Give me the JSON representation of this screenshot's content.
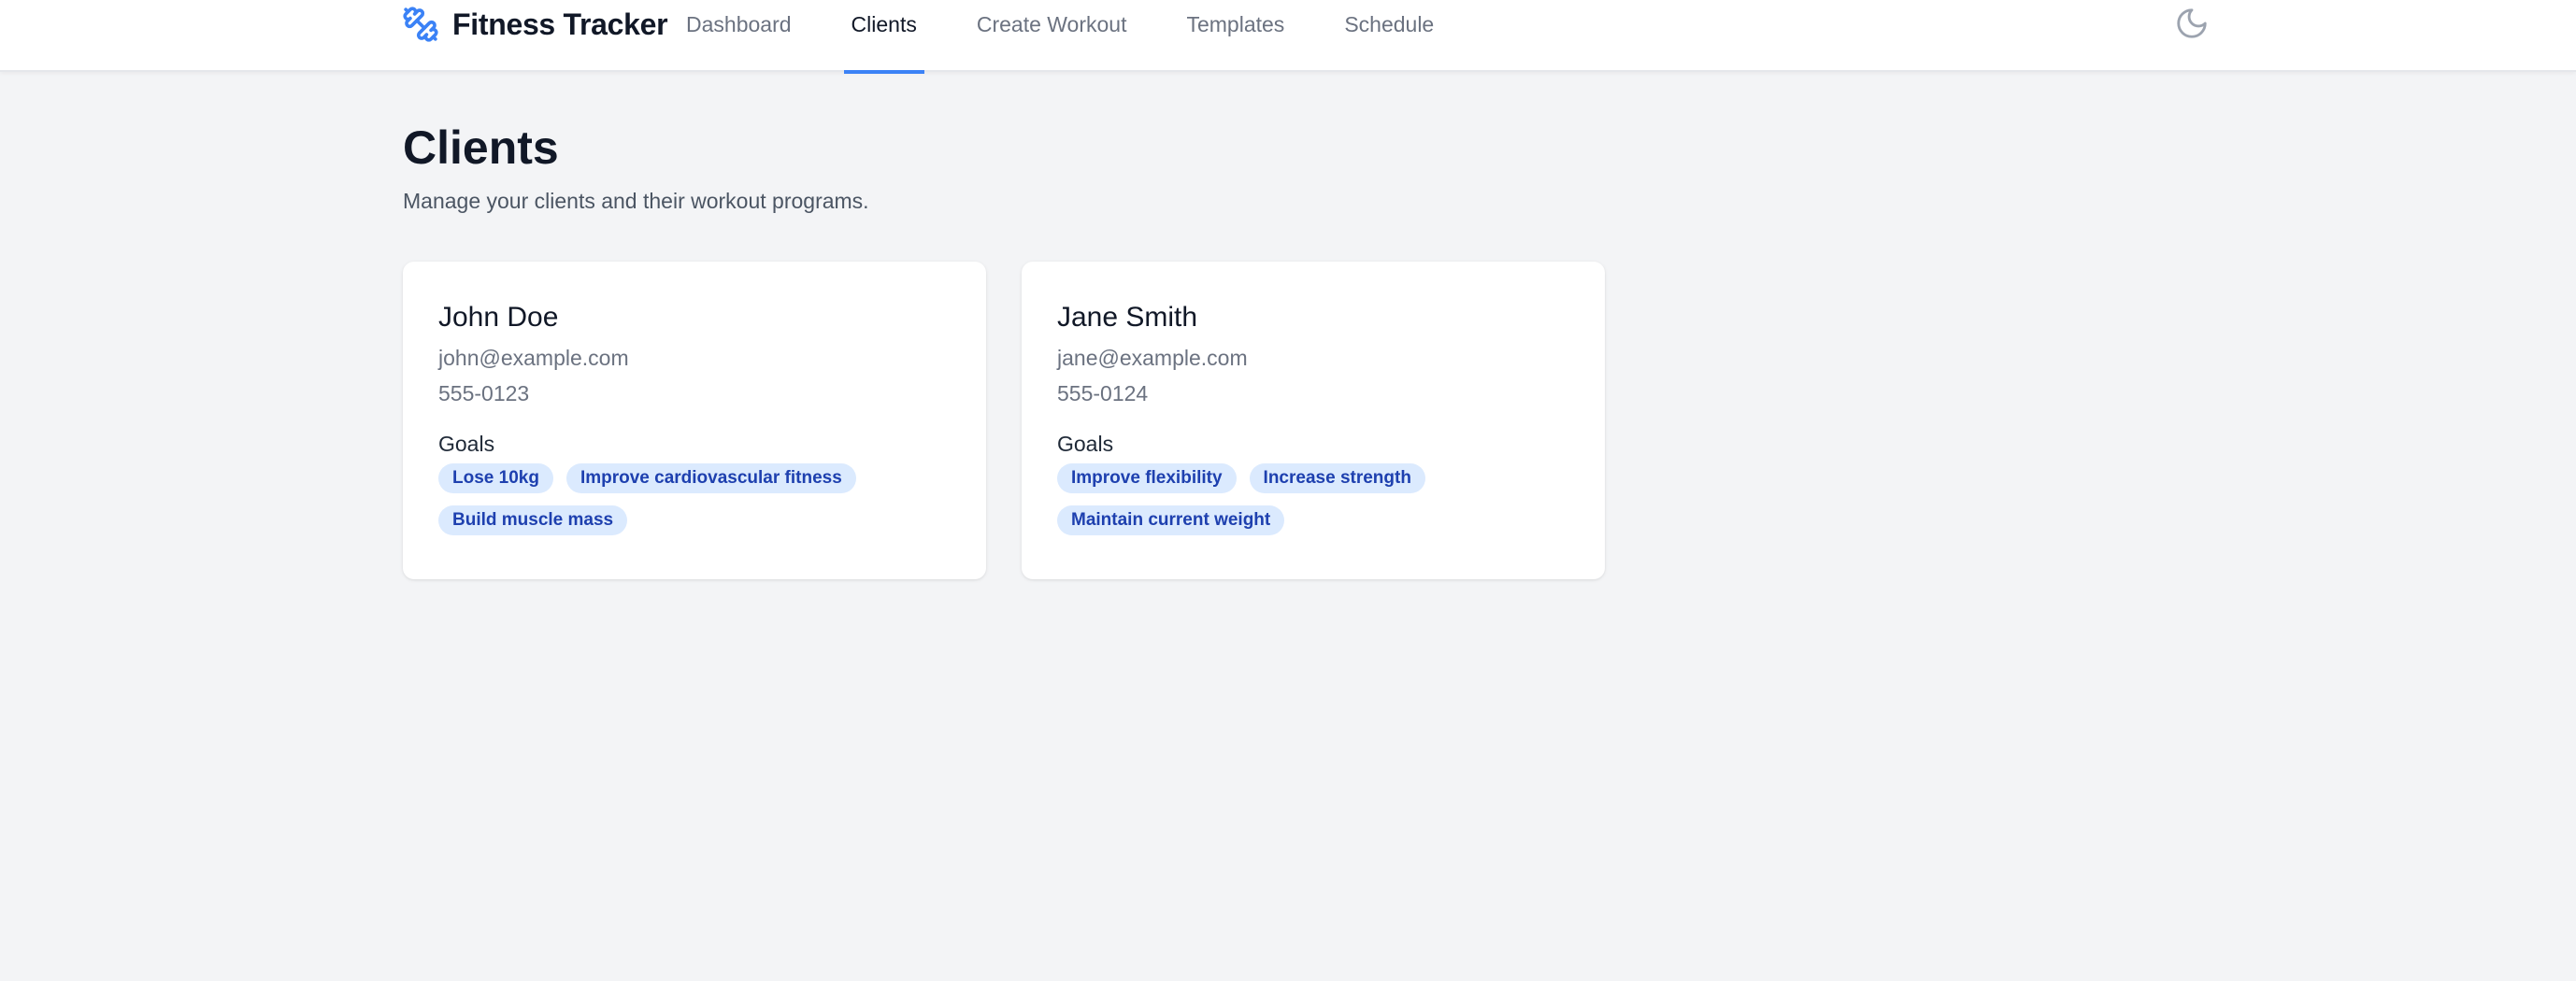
{
  "header": {
    "brand_title": "Fitness Tracker",
    "brand_icon": "dumbbell-icon",
    "theme_icon": "moon-icon",
    "accent_color": "#3b82f6",
    "nav": [
      {
        "label": "Dashboard",
        "active": false
      },
      {
        "label": "Clients",
        "active": true
      },
      {
        "label": "Create Workout",
        "active": false
      },
      {
        "label": "Templates",
        "active": false
      },
      {
        "label": "Schedule",
        "active": false
      }
    ]
  },
  "main": {
    "title": "Clients",
    "subtitle": "Manage your clients and their workout programs.",
    "goals_label": "Goals",
    "clients": [
      {
        "name": "John Doe",
        "email": "john@example.com",
        "phone": "555-0123",
        "goals": [
          "Lose 10kg",
          "Improve cardiovascular fitness",
          "Build muscle mass"
        ]
      },
      {
        "name": "Jane Smith",
        "email": "jane@example.com",
        "phone": "555-0124",
        "goals": [
          "Improve flexibility",
          "Increase strength",
          "Maintain current weight"
        ]
      }
    ]
  }
}
